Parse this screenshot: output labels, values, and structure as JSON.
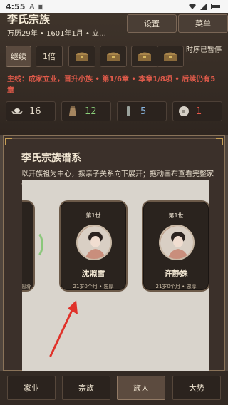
{
  "status_bar": {
    "time": "4:55",
    "left_icons": [
      "A",
      "▣"
    ],
    "right_icons": [
      "wifi",
      "signal",
      "battery"
    ]
  },
  "header": {
    "clan_name": "李氏宗族",
    "date_line": "万历29年 • 1601年1月 • 立…",
    "settings_label": "设置",
    "menu_label": "菜单"
  },
  "controls": {
    "continue_label": "继续",
    "speed_label": "1倍",
    "chests": [
      "chest-icon",
      "chest-icon",
      "chest-icon",
      "chest-icon"
    ],
    "pause_text": "时序已暂停"
  },
  "mainline_text": "主线：成家立业，晋升小族 • 第1/6章 • 本章1/8项 • 后续仍有5章",
  "resources": [
    {
      "icon": "silver-ingot-icon",
      "value": "16",
      "color": "#e6dccb"
    },
    {
      "icon": "grain-sack-icon",
      "value": "12",
      "color": "#8bd07a"
    },
    {
      "icon": "jade-icon",
      "value": "5",
      "color": "#8ab6e0"
    },
    {
      "icon": "coin-icon",
      "value": "1",
      "color": "#e8584a"
    }
  ],
  "modal": {
    "title": "李氏宗族谱系",
    "description": "以开族祖为中心，按亲子关系向下展开；拖动画布查看完整家谱，点卡片查看详情。"
  },
  "tree": {
    "partial_card_meta": "圆滑",
    "cards": [
      {
        "generation": "第1世",
        "name": "沈照雪",
        "meta": "21岁0个月 • 忠厚"
      },
      {
        "generation": "第1世",
        "name": "许静姝",
        "meta": "21岁0个月 • 忠厚"
      }
    ]
  },
  "tabs": [
    {
      "label": "家业",
      "active": false
    },
    {
      "label": "宗族",
      "active": false
    },
    {
      "label": "族人",
      "active": true
    },
    {
      "label": "大势",
      "active": false
    }
  ]
}
